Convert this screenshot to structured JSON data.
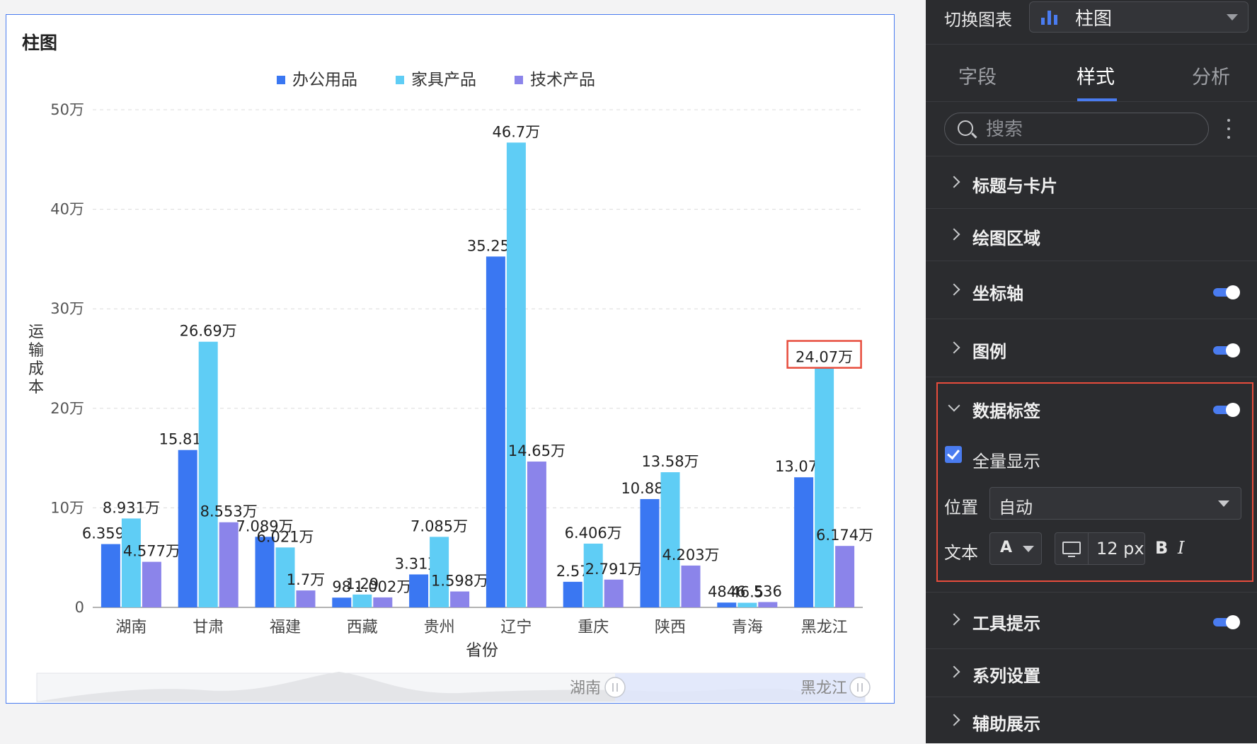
{
  "chart_card": {
    "title": "柱图"
  },
  "chart_data": {
    "type": "bar",
    "categories": [
      "湖南",
      "甘肃",
      "福建",
      "西藏",
      "贵州",
      "辽宁",
      "重庆",
      "陕西",
      "青海",
      "黑龙江"
    ],
    "series": [
      {
        "name": "办公用品",
        "color": "#3a77f2",
        "values": [
          63590,
          158100,
          70890,
          9800,
          33100,
          352500,
          25700,
          108800,
          4840,
          130700
        ],
        "labels": [
          "6.359万",
          "15.81万",
          "7.089万",
          "98",
          "3.31万",
          "35.25万",
          "2.57",
          "10.88万",
          "4846",
          "13.07万"
        ]
      },
      {
        "name": "家具产品",
        "color": "#5fcdf5",
        "values": [
          89310,
          266900,
          60210,
          12900,
          70850,
          467000,
          64060,
          135800,
          4650,
          240700
        ],
        "labels": [
          "8.931万",
          "26.69万",
          "6.021万",
          "1.29",
          "7.085万",
          "46.7万",
          "6.406万",
          "13.58万",
          "46.5",
          "24.07万"
        ]
      },
      {
        "name": "技术产品",
        "color": "#8b84ea",
        "values": [
          45770,
          85530,
          17000,
          10020,
          15980,
          146500,
          27910,
          42030,
          5360,
          61740
        ],
        "labels": [
          "4.577万",
          "8.553万",
          "1.7万",
          "1.002万",
          "1.598万",
          "14.65万",
          "2.791万",
          "4.203万",
          "536",
          "6.174万"
        ]
      }
    ],
    "yticks": [
      "0",
      "10万",
      "20万",
      "30万",
      "40万",
      "50万"
    ],
    "ylim": [
      0,
      500000
    ],
    "xlabel": "省份",
    "ylabel": "运输成本",
    "legend_position": "top-center",
    "grid": true,
    "highlighted_label": "24.07万",
    "slider": {
      "start_label": "湖南",
      "end_label": "黑龙江"
    }
  },
  "panel": {
    "switch_label": "切换图表",
    "chart_type": "柱图",
    "tabs": [
      "字段",
      "样式",
      "分析"
    ],
    "active_tab": "样式",
    "search_placeholder": "搜索",
    "sections": {
      "title_card": "标题与卡片",
      "plot_area": "绘图区域",
      "axis": "坐标轴",
      "legend": "图例",
      "data_label": "数据标签",
      "tooltip": "工具提示",
      "series": "系列设置",
      "aux": "辅助展示"
    },
    "data_label": {
      "show_all": "全量显示",
      "position_label": "位置",
      "position_value": "自动",
      "text_label": "文本",
      "font_color": "A",
      "font_size": "12 px",
      "bold": "B",
      "italic": "I"
    }
  }
}
